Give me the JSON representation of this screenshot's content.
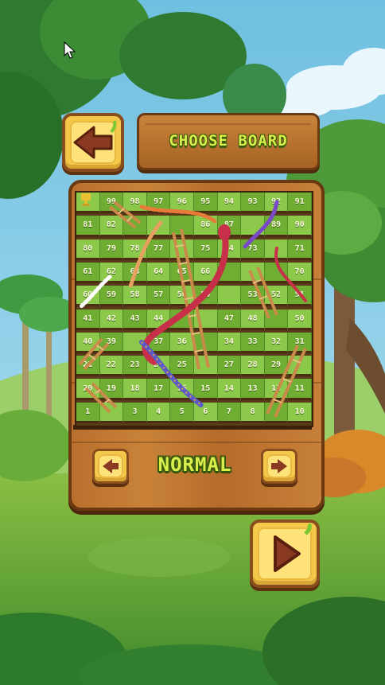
{
  "header": {
    "title": "CHOOSE BOARD"
  },
  "board": {
    "rows": [
      [
        "",
        "99",
        "98",
        "97",
        "96",
        "95",
        "94",
        "93",
        "92",
        "91"
      ],
      [
        "81",
        "82",
        "",
        "",
        "",
        "86",
        "87",
        "",
        "89",
        "90"
      ],
      [
        "80",
        "79",
        "78",
        "77",
        "",
        "75",
        "74",
        "73",
        "",
        "71"
      ],
      [
        "61",
        "62",
        "63",
        "64",
        "65",
        "66",
        "",
        "",
        "",
        "70"
      ],
      [
        "60",
        "59",
        "58",
        "57",
        "56",
        "55",
        "",
        "53",
        "52",
        "51"
      ],
      [
        "41",
        "42",
        "43",
        "44",
        "",
        "",
        "47",
        "48",
        "",
        "50"
      ],
      [
        "40",
        "39",
        "",
        "37",
        "36",
        "",
        "34",
        "33",
        "32",
        "31"
      ],
      [
        "21",
        "22",
        "23",
        "24",
        "25",
        "",
        "27",
        "28",
        "29",
        ""
      ],
      [
        "20",
        "19",
        "18",
        "17",
        "16",
        "15",
        "14",
        "13",
        "12",
        "11"
      ],
      [
        "1",
        "",
        "3",
        "4",
        "5",
        "6",
        "7",
        "8",
        "",
        "10"
      ]
    ]
  },
  "level": {
    "label": "NORMAL"
  },
  "icons": {
    "back": "arrow-left-icon",
    "play": "play-icon",
    "prev": "chevron-left-icon",
    "next": "chevron-right-icon",
    "trophy": "trophy-icon"
  },
  "colors": {
    "title_text": "#d9ee4a",
    "button_face": "#ffe27a",
    "wood": "#b9702e",
    "cell_light": "#8cc84a",
    "cell_dark": "#6fae33"
  }
}
